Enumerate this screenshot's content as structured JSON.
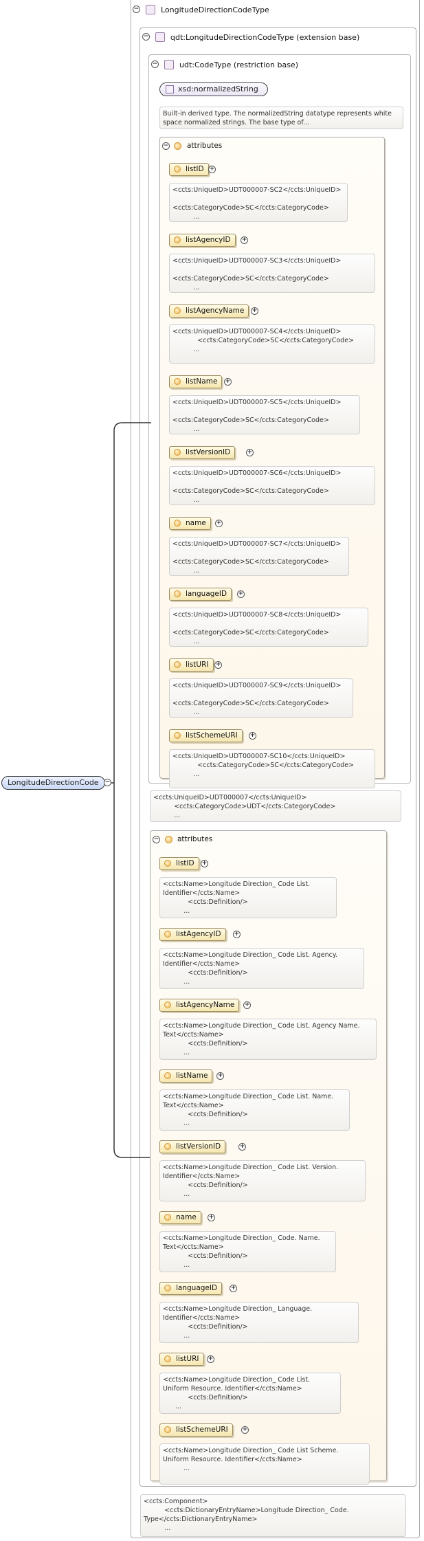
{
  "complex_type": {
    "label": "LongitudeDirectionCodeType"
  },
  "extension": {
    "label": "qdt:LongitudeDirectionCodeType (extension base)"
  },
  "restriction": {
    "label": "udt:CodeType (restriction base)"
  },
  "base_type": {
    "label": "xsd:normalizedString",
    "doc": "Built-in derived type. The normalizedString datatype represents white\nspace normalized strings. The base type of..."
  },
  "root_element": {
    "label": "LongitudeDirectionCode"
  },
  "inner_attributes": {
    "label": "attributes",
    "items": [
      {
        "name": "listID",
        "doc": "<ccts:UniqueID>UDT000007-SC2</ccts:UniqueID>\n\n<ccts:CategoryCode>SC</ccts:CategoryCode>\n          ..."
      },
      {
        "name": "listAgencyID",
        "doc": "<ccts:UniqueID>UDT000007-SC3</ccts:UniqueID>\n\n<ccts:CategoryCode>SC</ccts:CategoryCode>\n          ..."
      },
      {
        "name": "listAgencyName",
        "doc": "<ccts:UniqueID>UDT000007-SC4</ccts:UniqueID>\n            <ccts:CategoryCode>SC</ccts:CategoryCode>\n          ..."
      },
      {
        "name": "listName",
        "doc": "<ccts:UniqueID>UDT000007-SC5</ccts:UniqueID>\n\n<ccts:CategoryCode>SC</ccts:CategoryCode>\n          ..."
      },
      {
        "name": "listVersionID",
        "doc": "<ccts:UniqueID>UDT000007-SC6</ccts:UniqueID>\n\n<ccts:CategoryCode>SC</ccts:CategoryCode>\n          ..."
      },
      {
        "name": "name",
        "doc": "<ccts:UniqueID>UDT000007-SC7</ccts:UniqueID>\n\n<ccts:CategoryCode>SC</ccts:CategoryCode>\n          ..."
      },
      {
        "name": "languageID",
        "doc": "<ccts:UniqueID>UDT000007-SC8</ccts:UniqueID>\n\n<ccts:CategoryCode>SC</ccts:CategoryCode>\n          ..."
      },
      {
        "name": "listURI",
        "doc": "<ccts:UniqueID>UDT000007-SC9</ccts:UniqueID>\n\n<ccts:CategoryCode>SC</ccts:CategoryCode>\n          ..."
      },
      {
        "name": "listSchemeURI",
        "doc": "<ccts:UniqueID>UDT000007-SC10</ccts:UniqueID>\n            <ccts:CategoryCode>SC</ccts:CategoryCode>\n          ..."
      }
    ]
  },
  "udt_doc": "<ccts:UniqueID>UDT000007</ccts:UniqueID>\n          <ccts:CategoryCode>UDT</ccts:CategoryCode>\n          ...",
  "outer_attributes": {
    "label": "attributes",
    "items": [
      {
        "name": "listID",
        "doc": "<ccts:Name>Longitude Direction_ Code List.\nIdentifier</ccts:Name>\n            <ccts:Definition/>\n          ..."
      },
      {
        "name": "listAgencyID",
        "doc": "<ccts:Name>Longitude Direction_ Code List. Agency.\nIdentifier</ccts:Name>\n            <ccts:Definition/>\n          ..."
      },
      {
        "name": "listAgencyName",
        "doc": "<ccts:Name>Longitude Direction_ Code List. Agency Name.\nText</ccts:Name>\n            <ccts:Definition/>\n          ..."
      },
      {
        "name": "listName",
        "doc": "<ccts:Name>Longitude Direction_ Code List. Name.\nText</ccts:Name>\n            <ccts:Definition/>\n          ..."
      },
      {
        "name": "listVersionID",
        "doc": "<ccts:Name>Longitude Direction_ Code List. Version.\nIdentifier</ccts:Name>\n            <ccts:Definition/>\n          ..."
      },
      {
        "name": "name",
        "doc": "<ccts:Name>Longitude Direction_ Code. Name.\nText</ccts:Name>\n            <ccts:Definition/>\n          ..."
      },
      {
        "name": "languageID",
        "doc": "<ccts:Name>Longitude Direction_ Language.\nIdentifier</ccts:Name>\n            <ccts:Definition/>\n          ..."
      },
      {
        "name": "listURI",
        "doc": "<ccts:Name>Longitude Direction_ Code List.\nUniform Resource. Identifier</ccts:Name>\n            <ccts:Definition/>\n      ..."
      },
      {
        "name": "listSchemeURI",
        "doc": "<ccts:Name>Longitude Direction_ Code List Scheme.\nUniform Resource. Identifier</ccts:Name>\n          ..."
      }
    ]
  },
  "component_doc": "<ccts:Component>\n          <ccts:DictionaryEntryName>Longitude Direction_ Code.\nType</ccts:DictionaryEntryName>\n          ..."
}
